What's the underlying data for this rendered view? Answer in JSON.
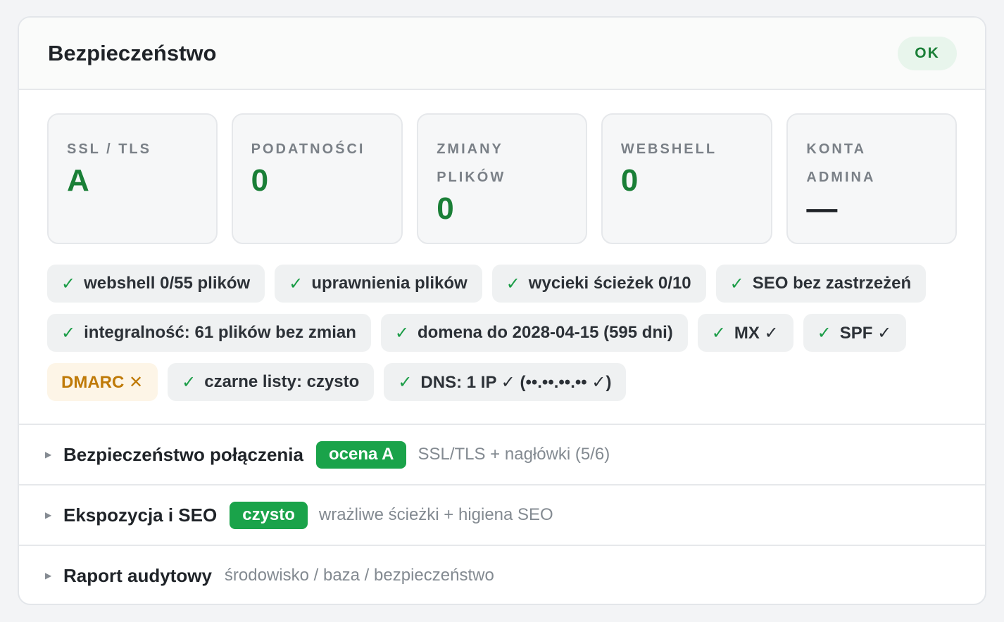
{
  "panel": {
    "title": "Bezpieczeństwo",
    "status": "OK"
  },
  "stats": [
    {
      "label": "SSL / TLS",
      "value": "A"
    },
    {
      "label": "PODATNOŚCI",
      "value": "0"
    },
    {
      "label": "ZMIANY PLIKÓW",
      "value": "0"
    },
    {
      "label": "WEBSHELL",
      "value": "0"
    },
    {
      "label": "KONTA ADMINA",
      "value": "—"
    }
  ],
  "checks": [
    {
      "text": "webshell 0/55 plików",
      "status": "ok"
    },
    {
      "text": "uprawnienia plików",
      "status": "ok"
    },
    {
      "text": "wycieki ścieżek 0/10",
      "status": "ok"
    },
    {
      "text": "SEO bez zastrzeżeń",
      "status": "ok"
    },
    {
      "text": "integralność: 61 plików bez zmian",
      "status": "ok"
    },
    {
      "text": "domena do 2028-04-15 (595 dni)",
      "status": "ok"
    },
    {
      "text": "MX ✓",
      "status": "ok"
    },
    {
      "text": "SPF ✓",
      "status": "ok"
    },
    {
      "text": "DMARC ✕",
      "status": "warn"
    },
    {
      "text": "czarne listy: czysto",
      "status": "ok"
    },
    {
      "text": "DNS: 1 IP ✓ (••.••.••.•• ✓)",
      "status": "ok"
    }
  ],
  "sections": [
    {
      "title": "Bezpieczeństwo połączenia",
      "badge": "ocena A",
      "desc": "SSL/TLS + nagłówki (5/6)"
    },
    {
      "title": "Ekspozycja i SEO",
      "badge": "czysto",
      "desc": "wrażliwe ścieżki + higiena SEO"
    },
    {
      "title": "Raport audytowy",
      "badge": "",
      "desc": "środowisko / baza / bezpieczeństwo"
    }
  ],
  "colors": {
    "ok": "#1a7f37",
    "badge": "#1aa34a",
    "warn": "#bf7a08"
  },
  "icons": {
    "check": "check-icon",
    "expand": "triangle-right-icon"
  }
}
